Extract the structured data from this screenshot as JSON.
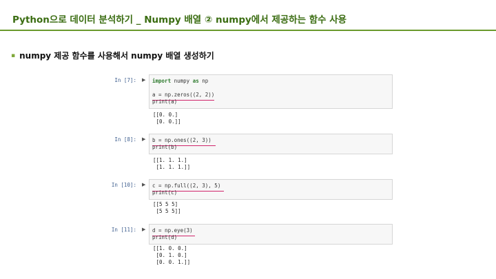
{
  "slide": {
    "title": "Python으로 데이터 분석하기 _ Numpy 배열 ② numpy에서 제공하는 함수 사용",
    "bullet": "numpy 제공 함수를 사용해서 numpy 배열 생성하기",
    "bullet_symbol": "▪"
  },
  "cells": [
    {
      "prompt": "In [7]:",
      "code": [
        "import numpy as np",
        "",
        "a = np.zeros((2, 2))",
        "print(a)"
      ],
      "output": [
        "[[0. 0.]",
        " [0. 0.]]"
      ]
    },
    {
      "prompt": "In [8]:",
      "code": [
        "b = np.ones((2, 3))",
        "print(b)"
      ],
      "output": [
        "[[1. 1. 1.]",
        " [1. 1. 1.]]"
      ]
    },
    {
      "prompt": "In [10]:",
      "code": [
        "c = np.full((2, 3), 5)",
        "print(c)"
      ],
      "output": [
        "[[5 5 5]",
        " [5 5 5]]"
      ]
    },
    {
      "prompt": "In [11]:",
      "code": [
        "d = np.eye(3)",
        "print(d)"
      ],
      "output": [
        "[[1. 0. 0.]",
        " [0. 1. 0.]",
        " [0. 0. 1.]]"
      ]
    }
  ],
  "colors": {
    "title": "#3b6d12",
    "rule": "#6a9a2c",
    "underline": "#d0246a",
    "prompt": "#3f5f8f"
  },
  "icons": {
    "run": "run-cell-icon"
  }
}
